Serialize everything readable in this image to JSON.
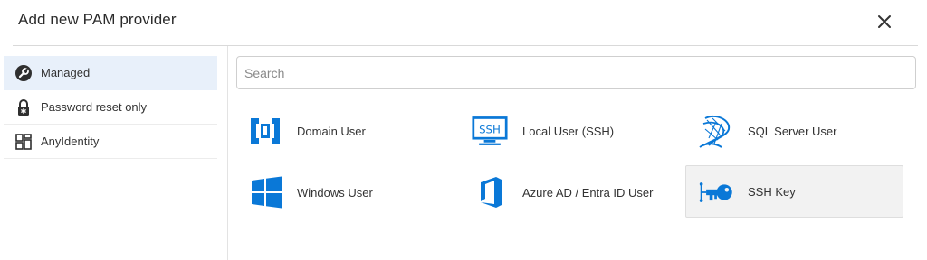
{
  "dialog": {
    "title": "Add new PAM provider",
    "close_label": "close"
  },
  "sidebar": {
    "items": [
      {
        "label": "Managed",
        "icon": "wrench-circle-icon",
        "active": true
      },
      {
        "label": "Password reset only",
        "icon": "padlock-asterisk-icon",
        "active": false
      },
      {
        "label": "AnyIdentity",
        "icon": "grid-blocks-icon",
        "active": false
      }
    ]
  },
  "search": {
    "placeholder": "Search",
    "value": ""
  },
  "providers": [
    {
      "label": "Domain User",
      "icon": "domain-user-icon"
    },
    {
      "label": "Local User (SSH)",
      "icon": "ssh-monitor-icon"
    },
    {
      "label": "SQL Server User",
      "icon": "sql-server-icon"
    },
    {
      "label": "Windows User",
      "icon": "windows-logo-icon"
    },
    {
      "label": "Azure AD / Entra ID User",
      "icon": "office-logo-icon"
    },
    {
      "label": "SSH Key",
      "icon": "ssh-key-icon",
      "selected": true
    }
  ],
  "colors": {
    "accent": "#0a78d7",
    "active_bg": "#e8f0fa",
    "selected_tile_bg": "#f2f2f2",
    "icon_dark": "#2f2f2f"
  }
}
